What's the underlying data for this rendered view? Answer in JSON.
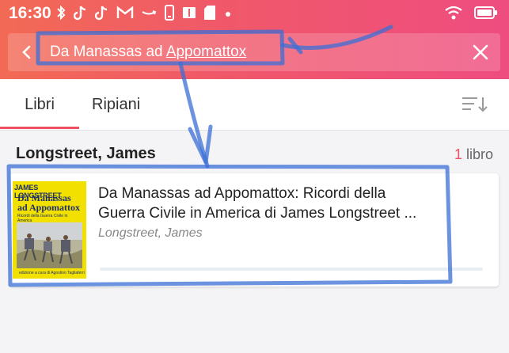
{
  "status_bar": {
    "time": "16:30",
    "notification_icons": [
      "bluetooth-icon",
      "tiktok-icon",
      "tiktok-icon",
      "gmail-icon",
      "amazon-icon",
      "phone-icon",
      "book-icon",
      "sd-card-icon",
      "dot-icon"
    ],
    "system_icons": [
      "wifi-icon",
      "battery-icon"
    ]
  },
  "search": {
    "query_part1": "Da Manassas ad ",
    "query_part2": "Appomattox"
  },
  "tabs": [
    {
      "label": "Libri",
      "active": true
    },
    {
      "label": "Ripiani",
      "active": false
    }
  ],
  "group": {
    "author": "Longstreet, James",
    "count": "1",
    "count_label": "libro"
  },
  "book": {
    "title_line1": "Da Manassas ad Appomattox: Ricordi della",
    "title_line2": "Guerra Civile in America di James Longstreet ...",
    "author": "Longstreet, James",
    "progress": 0,
    "cover": {
      "top_text": "JAMES LONGSTREET",
      "title": "Da Manassas ad Appomattox",
      "subtitle": "Ricordi della Guerra Civile in America",
      "bottom_text": "edizione a cura di Agostino Tagliaferri"
    }
  },
  "colors": {
    "accent": "#ef5060",
    "header_start": "#f26a55",
    "header_end": "#ee4d80",
    "cover_yellow": "#f1e000",
    "annotation_blue": "#3b6fd6"
  }
}
